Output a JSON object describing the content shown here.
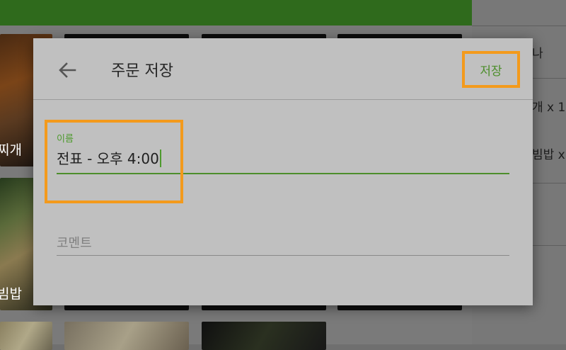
{
  "background": {
    "menu_labels": [
      "찌개",
      "빔밥"
    ],
    "side_panel_lines": [
      "나",
      "개 x 1",
      "빔밥 x"
    ]
  },
  "dialog": {
    "back_icon": "arrow-left-icon",
    "title": "주문 저장",
    "save_label": "저장",
    "name_field": {
      "label": "이름",
      "value": "전표 - 오후 4:00"
    },
    "comment_field": {
      "placeholder": "코멘트",
      "value": ""
    }
  },
  "colors": {
    "accent_green": "#4d8e2c",
    "highlight_orange": "#f39a1c",
    "dialog_bg": "#c0c0c0"
  }
}
